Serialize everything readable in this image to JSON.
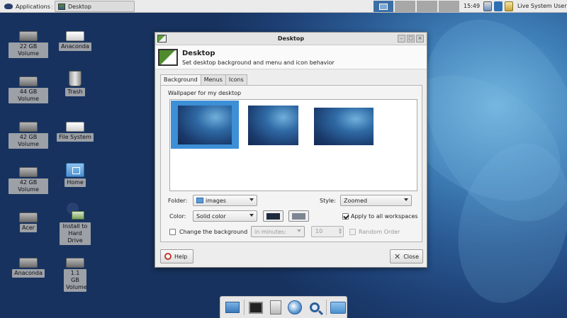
{
  "top_panel": {
    "applications_label": "Applications",
    "active_task": "Desktop",
    "clock": "15:49",
    "user": "Live System User"
  },
  "desktop_icons": [
    {
      "label": "22 GB Volume",
      "icon": "drive-icon"
    },
    {
      "label": "Anaconda",
      "icon": "drive-icon"
    },
    {
      "label": "44 GB Volume",
      "icon": "drive-icon"
    },
    {
      "label": "Trash",
      "icon": "trash-icon"
    },
    {
      "label": "42 GB Volume",
      "icon": "drive-icon"
    },
    {
      "label": "File System",
      "icon": "drive-icon"
    },
    {
      "label": "42 GB Volume",
      "icon": "drive-icon"
    },
    {
      "label": "Home",
      "icon": "home-folder-icon"
    },
    {
      "label": "Acer",
      "icon": "drive-icon"
    },
    {
      "label": "Install to Hard Drive",
      "icon": "install-icon"
    },
    {
      "label": "Anaconda",
      "icon": "drive-icon"
    },
    {
      "label": "1.1 GB Volume",
      "icon": "drive-icon"
    }
  ],
  "dialog": {
    "title": "Desktop",
    "header_title": "Desktop",
    "header_subtitle": "Set desktop background and menu and icon behavior",
    "tabs": [
      "Background",
      "Menus",
      "Icons"
    ],
    "wallpaper_label": "Wallpaper for my desktop",
    "folder_label": "Folder:",
    "folder_value": "images",
    "style_label": "Style:",
    "style_value": "Zoomed",
    "color_label": "Color:",
    "color_value": "Solid color",
    "primary_color": "#1c2a3c",
    "secondary_color": "#7d8592",
    "apply_all_label": "Apply to all workspaces",
    "apply_all_checked": true,
    "change_bg_label": "Change the background",
    "change_bg_checked": false,
    "interval_unit": "in minutes:",
    "interval_value": "10",
    "random_order_label": "Random Order",
    "help_label": "Help",
    "close_label": "Close"
  },
  "colors": {
    "selection": "#3d8fd6",
    "workspace_active": "#3d6fa5"
  }
}
